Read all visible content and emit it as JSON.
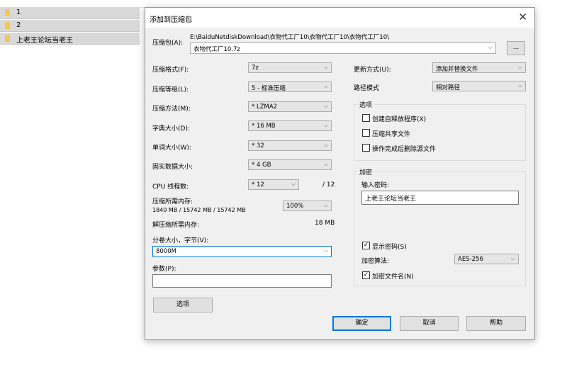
{
  "file_list": [
    {
      "name": "1"
    },
    {
      "name": "2"
    },
    {
      "name": "上老王论坛当老王"
    }
  ],
  "dialog": {
    "title": "添加到压缩包",
    "close_glyph": "✕",
    "archive": {
      "label": "压缩包(A):",
      "path": "E:\\BaiduNetdiskDownload\\衣物代工厂10\\衣物代工厂10\\衣物代工厂10\\",
      "name": "衣物代工厂10.7z",
      "browse_label": "..."
    },
    "left": {
      "format": {
        "label": "压缩格式(F):",
        "value": "7z"
      },
      "level": {
        "label": "压缩等级(L):",
        "value": "5 - 标准压缩"
      },
      "method": {
        "label": "压缩方法(M):",
        "value": "* LZMA2"
      },
      "dict": {
        "label": "字典大小(D):",
        "value": "* 16 MB"
      },
      "word": {
        "label": "单词大小(W):",
        "value": "* 32"
      },
      "solid": {
        "label": "固实数据大小:",
        "value": "* 4 GB"
      },
      "threads": {
        "label": "CPU 线程数:",
        "value": "* 12",
        "max": "/ 12"
      },
      "comp_mem": {
        "label": "压缩所需内存:",
        "detail": "1840 MB / 15742 MB / 15742 MB",
        "percent": "100%"
      },
      "decomp_mem": {
        "label": "解压缩所需内存:",
        "value": "18 MB"
      },
      "volume": {
        "label": "分卷大小，字节(V):",
        "value": "8000M"
      },
      "params": {
        "label": "参数(P):",
        "value": ""
      },
      "options_button": "选项"
    },
    "right": {
      "update": {
        "label": "更新方式(U):",
        "value": "添加并替换文件"
      },
      "path_mode": {
        "label": "路径模式",
        "value": "相对路径"
      },
      "options_group": {
        "title": "选项",
        "items": [
          {
            "label": "创建自释放程序(X)",
            "checked": false
          },
          {
            "label": "压缩共享文件",
            "checked": false
          },
          {
            "label": "操作完成后删除源文件",
            "checked": false
          }
        ]
      },
      "encryption": {
        "title": "加密",
        "password_label": "输入密码:",
        "password_value": "上老王论坛当老王",
        "show_password": {
          "label": "显示密码(S)",
          "checked": true
        },
        "method_label": "加密算法:",
        "method_value": "AES-256",
        "encrypt_names": {
          "label": "加密文件名(N)",
          "checked": true
        }
      }
    },
    "buttons": {
      "ok": "确定",
      "cancel": "取消",
      "help": "帮助"
    }
  }
}
